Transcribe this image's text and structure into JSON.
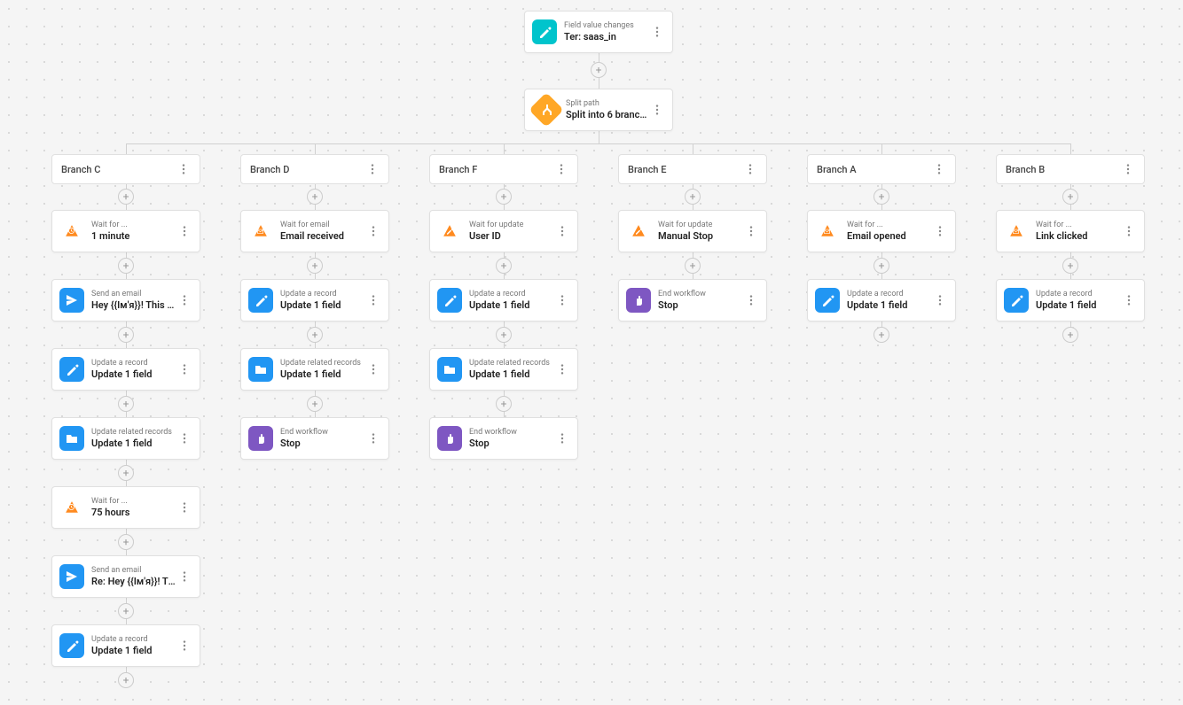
{
  "trigger": {
    "sub": "Field value changes",
    "title": "Ter: saas_in"
  },
  "split": {
    "sub": "Split path",
    "title": "Split into 6 branches"
  },
  "branches": {
    "c": {
      "label": "Branch C"
    },
    "d": {
      "label": "Branch D"
    },
    "f": {
      "label": "Branch F"
    },
    "e": {
      "label": "Branch E"
    },
    "a": {
      "label": "Branch A"
    },
    "b": {
      "label": "Branch B"
    }
  },
  "c": {
    "n1": {
      "sub": "Wait for ...",
      "title": "1 minute"
    },
    "n2": {
      "sub": "Send an email",
      "title": "Hey {{Ім'я}}! This is t..."
    },
    "n3": {
      "sub": "Update a record",
      "title": "Update 1 field"
    },
    "n4": {
      "sub": "Update related records",
      "title": "Update 1 field"
    },
    "n5": {
      "sub": "Wait for ...",
      "title": "75 hours"
    },
    "n6": {
      "sub": "Send an email",
      "title": "Re: Hey {{Ім'я}}! This ..."
    },
    "n7": {
      "sub": "Update a record",
      "title": "Update 1 field"
    }
  },
  "d": {
    "n1": {
      "sub": "Wait for email",
      "title": "Email received"
    },
    "n2": {
      "sub": "Update a record",
      "title": "Update 1 field"
    },
    "n3": {
      "sub": "Update related records",
      "title": "Update 1 field"
    },
    "n4": {
      "sub": "End workflow",
      "title": "Stop"
    }
  },
  "f": {
    "n1": {
      "sub": "Wait for update",
      "title": "User ID"
    },
    "n2": {
      "sub": "Update a record",
      "title": "Update 1 field"
    },
    "n3": {
      "sub": "Update related records",
      "title": "Update 1 field"
    },
    "n4": {
      "sub": "End workflow",
      "title": "Stop"
    }
  },
  "e": {
    "n1": {
      "sub": "Wait for update",
      "title": "Manual Stop"
    },
    "n2": {
      "sub": "End workflow",
      "title": "Stop"
    }
  },
  "a": {
    "n1": {
      "sub": "Wait for ...",
      "title": "Email opened"
    },
    "n2": {
      "sub": "Update a record",
      "title": "Update 1 field"
    }
  },
  "b": {
    "n1": {
      "sub": "Wait for ...",
      "title": "Link clicked"
    },
    "n2": {
      "sub": "Update a record",
      "title": "Update 1 field"
    }
  }
}
